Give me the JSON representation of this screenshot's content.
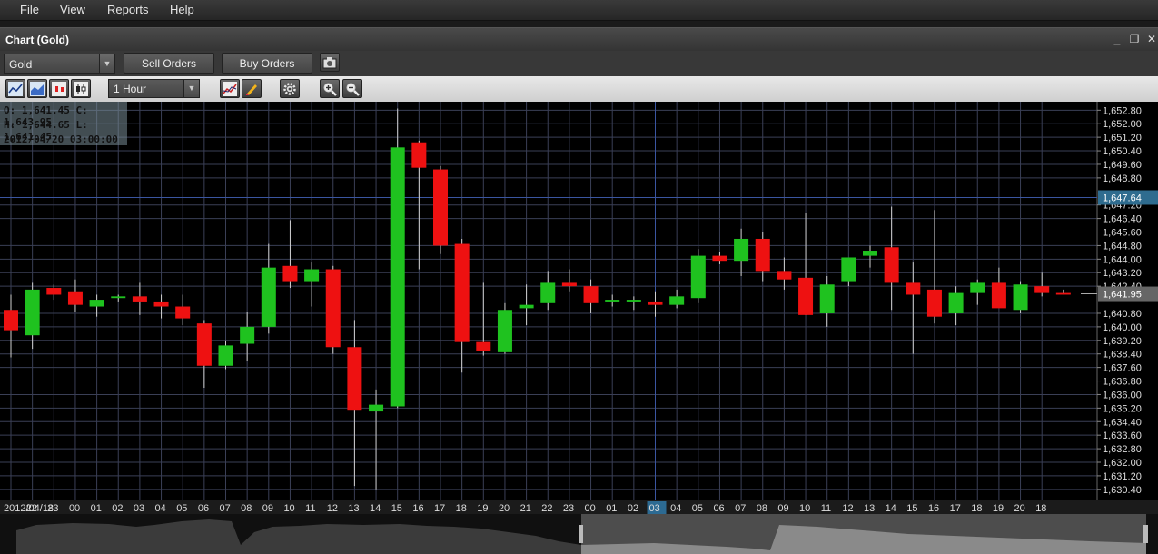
{
  "menu": {
    "items": [
      "File",
      "View",
      "Reports",
      "Help"
    ]
  },
  "window": {
    "title": "Chart (Gold)",
    "minimize": "_",
    "restore": "❐",
    "close": "✕"
  },
  "toolbar": {
    "symbol": "Gold",
    "sell_orders": "Sell Orders",
    "buy_orders": "Buy Orders",
    "timeframe": "1 Hour",
    "icons": [
      "line-chart-icon",
      "area-chart-icon",
      "bar-chart-icon",
      "candlestick-chart-icon",
      "indicators-icon",
      "draw-pencil-icon",
      "settings-gear-icon",
      "zoom-in-icon",
      "zoom-out-icon",
      "camera-icon"
    ]
  },
  "info": {
    "oc": "O: 1,641.45 C: 1,643.95",
    "hl": "H: 1,644.65 L: 1,641.45",
    "time": "2012/04/20 03:00:00"
  },
  "colors": {
    "up": "#1fc21f",
    "down": "#ee1111",
    "grid": "#3a3f56",
    "crosshair": "#3a55a0",
    "price_tag": "#2f6c8f"
  },
  "chart_data": {
    "type": "candlestick",
    "title": "",
    "ylim": [
      1629.8,
      1653.3
    ],
    "y_ticks": [
      "1,652.80",
      "1,652.00",
      "1,651.20",
      "1,650.40",
      "1,649.60",
      "1,648.80",
      "1,647.20",
      "1,646.40",
      "1,645.60",
      "1,644.80",
      "1,644.00",
      "1,643.20",
      "1,642.40",
      "1,640.80",
      "1,640.00",
      "1,639.20",
      "1,638.40",
      "1,637.60",
      "1,636.80",
      "1,636.00",
      "1,635.20",
      "1,634.40",
      "1,633.60",
      "1,632.80",
      "1,632.00",
      "1,631.20",
      "1,630.40"
    ],
    "x_labels": [
      "2012/04/18",
      "22",
      "23",
      "00",
      "01",
      "02",
      "03",
      "04",
      "05",
      "06",
      "07",
      "08",
      "09",
      "10",
      "11",
      "12",
      "13",
      "14",
      "15",
      "16",
      "17",
      "18",
      "19",
      "20",
      "21",
      "22",
      "23",
      "00",
      "01",
      "02",
      "03",
      "04",
      "05",
      "06",
      "07",
      "08",
      "09",
      "10",
      "11",
      "12",
      "13",
      "14",
      "15",
      "16",
      "17",
      "18",
      "19",
      "20",
      "18"
    ],
    "highlighted_x_label": "03",
    "crosshair_price": "1,647.64",
    "last_price": "1,641.95",
    "candles": [
      {
        "o": 1641.0,
        "h": 1641.9,
        "l": 1638.2,
        "c": 1639.8
      },
      {
        "o": 1639.5,
        "h": 1642.6,
        "l": 1638.7,
        "c": 1642.2
      },
      {
        "o": 1642.3,
        "h": 1642.5,
        "l": 1641.6,
        "c": 1641.9
      },
      {
        "o": 1642.1,
        "h": 1642.8,
        "l": 1640.9,
        "c": 1641.3
      },
      {
        "o": 1641.2,
        "h": 1641.9,
        "l": 1640.6,
        "c": 1641.6
      },
      {
        "o": 1641.7,
        "h": 1641.9,
        "l": 1641.5,
        "c": 1641.8
      },
      {
        "o": 1641.8,
        "h": 1642.6,
        "l": 1640.7,
        "c": 1641.5
      },
      {
        "o": 1641.5,
        "h": 1641.9,
        "l": 1640.5,
        "c": 1641.2
      },
      {
        "o": 1641.2,
        "h": 1641.9,
        "l": 1640.1,
        "c": 1640.5
      },
      {
        "o": 1640.2,
        "h": 1640.4,
        "l": 1636.4,
        "c": 1637.7
      },
      {
        "o": 1637.7,
        "h": 1639.2,
        "l": 1637.5,
        "c": 1638.9
      },
      {
        "o": 1639.0,
        "h": 1640.9,
        "l": 1638.0,
        "c": 1640.0
      },
      {
        "o": 1640.0,
        "h": 1644.9,
        "l": 1639.6,
        "c": 1643.5
      },
      {
        "o": 1643.6,
        "h": 1646.3,
        "l": 1642.3,
        "c": 1642.7
      },
      {
        "o": 1642.7,
        "h": 1643.8,
        "l": 1641.2,
        "c": 1643.4
      },
      {
        "o": 1643.4,
        "h": 1643.6,
        "l": 1638.4,
        "c": 1638.8
      },
      {
        "o": 1638.8,
        "h": 1640.4,
        "l": 1630.6,
        "c": 1635.1
      },
      {
        "o": 1635.0,
        "h": 1636.3,
        "l": 1630.4,
        "c": 1635.4
      },
      {
        "o": 1635.3,
        "h": 1652.9,
        "l": 1635.2,
        "c": 1650.6
      },
      {
        "o": 1650.9,
        "h": 1651.0,
        "l": 1643.4,
        "c": 1649.4
      },
      {
        "o": 1649.3,
        "h": 1649.5,
        "l": 1644.3,
        "c": 1644.8
      },
      {
        "o": 1644.9,
        "h": 1645.2,
        "l": 1637.3,
        "c": 1639.1
      },
      {
        "o": 1639.1,
        "h": 1642.6,
        "l": 1638.3,
        "c": 1638.6
      },
      {
        "o": 1638.5,
        "h": 1641.4,
        "l": 1638.4,
        "c": 1641.0
      },
      {
        "o": 1641.1,
        "h": 1642.5,
        "l": 1640.1,
        "c": 1641.3
      },
      {
        "o": 1641.4,
        "h": 1643.3,
        "l": 1641.0,
        "c": 1642.6
      },
      {
        "o": 1642.6,
        "h": 1643.4,
        "l": 1642.1,
        "c": 1642.4
      },
      {
        "o": 1642.4,
        "h": 1642.8,
        "l": 1640.8,
        "c": 1641.4
      },
      {
        "o": 1641.5,
        "h": 1641.9,
        "l": 1641.2,
        "c": 1641.6
      },
      {
        "o": 1641.5,
        "h": 1641.8,
        "l": 1641.0,
        "c": 1641.6
      },
      {
        "o": 1641.5,
        "h": 1642.1,
        "l": 1640.6,
        "c": 1641.3
      },
      {
        "o": 1641.3,
        "h": 1642.2,
        "l": 1641.1,
        "c": 1641.8
      },
      {
        "o": 1641.7,
        "h": 1644.6,
        "l": 1641.4,
        "c": 1644.2
      },
      {
        "o": 1644.2,
        "h": 1644.4,
        "l": 1643.7,
        "c": 1643.9
      },
      {
        "o": 1643.9,
        "h": 1645.8,
        "l": 1643.0,
        "c": 1645.2
      },
      {
        "o": 1645.2,
        "h": 1645.6,
        "l": 1642.7,
        "c": 1643.3
      },
      {
        "o": 1643.3,
        "h": 1644.1,
        "l": 1642.2,
        "c": 1642.8
      },
      {
        "o": 1642.9,
        "h": 1646.7,
        "l": 1640.7,
        "c": 1640.7
      },
      {
        "o": 1640.8,
        "h": 1643.0,
        "l": 1640.0,
        "c": 1642.5
      },
      {
        "o": 1642.7,
        "h": 1644.0,
        "l": 1642.4,
        "c": 1644.1
      },
      {
        "o": 1644.2,
        "h": 1644.8,
        "l": 1643.5,
        "c": 1644.5
      },
      {
        "o": 1644.7,
        "h": 1647.1,
        "l": 1641.0,
        "c": 1642.6
      },
      {
        "o": 1642.6,
        "h": 1643.8,
        "l": 1638.4,
        "c": 1641.9
      },
      {
        "o": 1642.2,
        "h": 1646.9,
        "l": 1640.2,
        "c": 1640.6
      },
      {
        "o": 1640.8,
        "h": 1642.4,
        "l": 1640.1,
        "c": 1642.0
      },
      {
        "o": 1642.0,
        "h": 1642.8,
        "l": 1641.3,
        "c": 1642.6
      },
      {
        "o": 1642.6,
        "h": 1643.5,
        "l": 1641.2,
        "c": 1641.1
      },
      {
        "o": 1641.0,
        "h": 1642.7,
        "l": 1640.8,
        "c": 1642.5
      },
      {
        "o": 1642.4,
        "h": 1643.2,
        "l": 1641.8,
        "c": 1642.0
      },
      {
        "o": 1642.0,
        "h": 1642.2,
        "l": 1641.9,
        "c": 1641.9
      }
    ]
  }
}
